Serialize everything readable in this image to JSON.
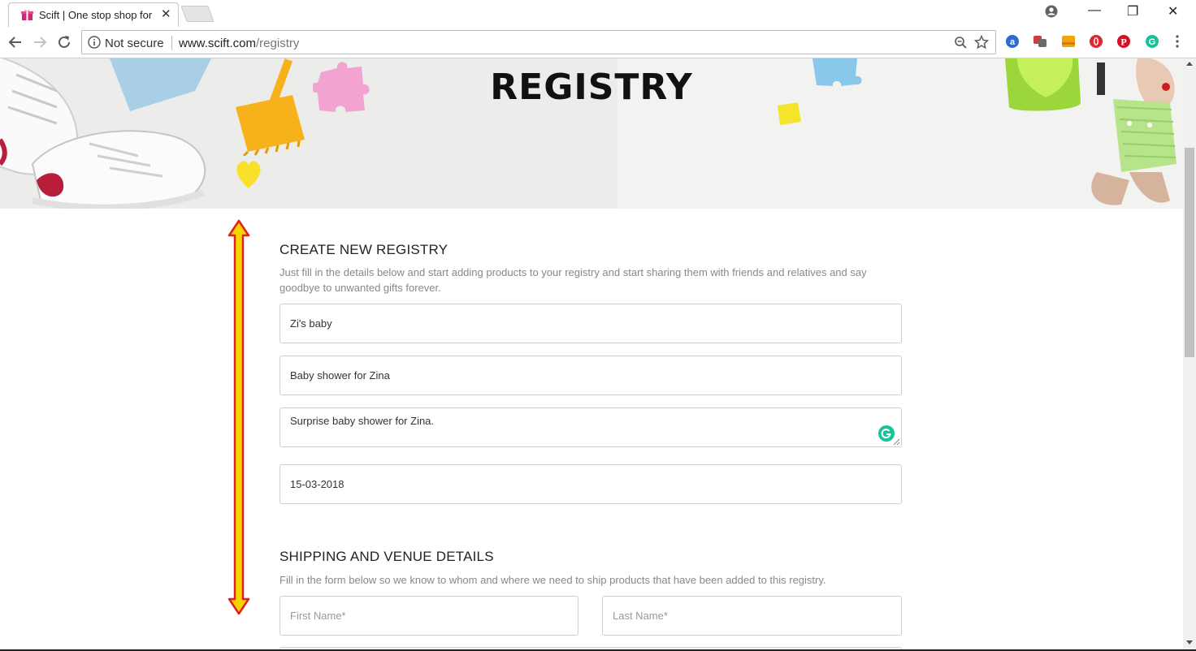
{
  "browser": {
    "tab_title": "Scift | One stop shop for",
    "tab_close": "✕",
    "not_secure": "Not secure",
    "url_host": "www.scift.com",
    "url_path": "/registry",
    "window_controls": {
      "minimize": "—",
      "restore": "❐",
      "close": "✕"
    },
    "extension_icons": [
      "a-extension-icon",
      "translate-icon",
      "note-icon",
      "opera-icon",
      "pinterest-icon",
      "grammarly-icon"
    ]
  },
  "hero": {
    "title": "REGISTRY"
  },
  "create_section": {
    "title": "CREATE NEW REGISTRY",
    "description": "Just fill in the details below and start adding products to your registry and start sharing them with friends and relatives and say goodbye to unwanted gifts forever.",
    "fields": {
      "registry_name": "Zi's baby",
      "event_title": "Baby shower for Zina",
      "event_description": "Surprise baby shower for Zina.",
      "event_date": "15-03-2018"
    }
  },
  "shipping_section": {
    "title": "SHIPPING AND VENUE DETAILS",
    "description": "Fill in the form below so we know to whom and where we need to ship products that have been added to this registry.",
    "first_name_placeholder": "First Name*",
    "last_name_placeholder": "Last Name*"
  },
  "colors": {
    "arrow_fill": "#f5d400",
    "arrow_stroke": "#e02020",
    "grammarly": "#15c39a"
  }
}
